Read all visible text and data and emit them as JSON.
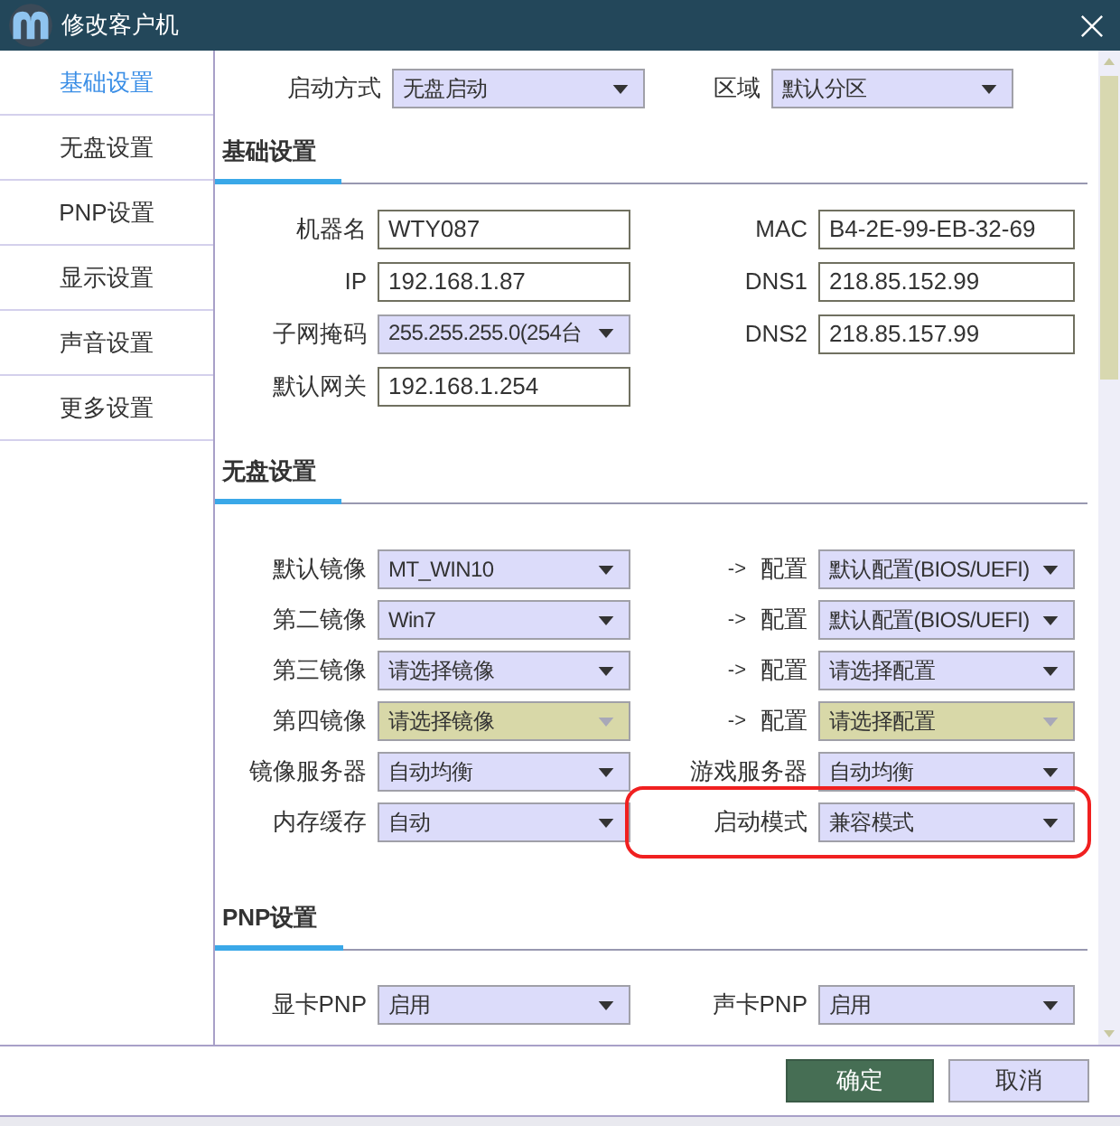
{
  "window": {
    "title": "修改客户机"
  },
  "sidebar": {
    "items": [
      {
        "label": "基础设置",
        "selected": true
      },
      {
        "label": "无盘设置",
        "selected": false
      },
      {
        "label": "PNP设置",
        "selected": false
      },
      {
        "label": "显示设置",
        "selected": false
      },
      {
        "label": "声音设置",
        "selected": false
      },
      {
        "label": "更多设置",
        "selected": false
      }
    ]
  },
  "top_row": {
    "left": {
      "label": "启动方式",
      "value": "无盘启动",
      "kind": "select"
    },
    "right": {
      "label": "区域",
      "value": "默认分区",
      "kind": "select"
    }
  },
  "sections": [
    {
      "title": "基础设置",
      "rows": [
        {
          "left": {
            "label": "机器名",
            "value": "WTY087",
            "kind": "input"
          },
          "right": {
            "label": "MAC",
            "value": "B4-2E-99-EB-32-69",
            "kind": "input"
          }
        },
        {
          "left": {
            "label": "IP",
            "value": "192.168.1.87",
            "kind": "input"
          },
          "right": {
            "label": "DNS1",
            "value": "218.85.152.99",
            "kind": "input"
          }
        },
        {
          "left": {
            "label": "子网掩码",
            "value": "255.255.255.0(254台",
            "kind": "select"
          },
          "right": {
            "label": "DNS2",
            "value": "218.85.157.99",
            "kind": "input"
          }
        },
        {
          "left": {
            "label": "默认网关",
            "value": "192.168.1.254",
            "kind": "input"
          }
        }
      ]
    },
    {
      "title": "无盘设置",
      "rows": [
        {
          "left": {
            "label": "默认镜像",
            "value": "MT_WIN10",
            "kind": "select",
            "disabled": false
          },
          "right": {
            "arrow": "->",
            "label": "配置",
            "value": "默认配置(BIOS/UEFI)",
            "kind": "select",
            "disabled": false,
            "highlighted": false
          }
        },
        {
          "left": {
            "label": "第二镜像",
            "value": "Win7",
            "kind": "select",
            "disabled": false
          },
          "right": {
            "arrow": "->",
            "label": "配置",
            "value": "默认配置(BIOS/UEFI)",
            "kind": "select",
            "disabled": false,
            "highlighted": false
          }
        },
        {
          "left": {
            "label": "第三镜像",
            "value": "请选择镜像",
            "kind": "select",
            "disabled": false
          },
          "right": {
            "arrow": "->",
            "label": "配置",
            "value": "请选择配置",
            "kind": "select",
            "disabled": false,
            "highlighted": false
          }
        },
        {
          "left": {
            "label": "第四镜像",
            "value": "请选择镜像",
            "kind": "select",
            "disabled": true
          },
          "right": {
            "arrow": "->",
            "label": "配置",
            "value": "请选择配置",
            "kind": "select",
            "disabled": true,
            "highlighted": false
          }
        },
        {
          "left": {
            "label": "镜像服务器",
            "value": "自动均衡",
            "kind": "select",
            "disabled": false
          },
          "right": {
            "label": "游戏服务器",
            "value": "自动均衡",
            "kind": "select",
            "disabled": false,
            "highlighted": false
          }
        },
        {
          "left": {
            "label": "内存缓存",
            "value": "自动",
            "kind": "select",
            "disabled": false
          },
          "right": {
            "label": "启动模式",
            "value": "兼容模式",
            "kind": "select",
            "disabled": false,
            "highlighted": true
          }
        }
      ]
    },
    {
      "title": "PNP设置",
      "rows": [
        {
          "left": {
            "label": "显卡PNP",
            "value": "启用",
            "kind": "select"
          },
          "right": {
            "label": "声卡PNP",
            "value": "启用",
            "kind": "select"
          }
        }
      ]
    }
  ],
  "buttons": [
    {
      "label": "确定",
      "kind": "primary"
    },
    {
      "label": "取消",
      "kind": "secondary"
    }
  ]
}
